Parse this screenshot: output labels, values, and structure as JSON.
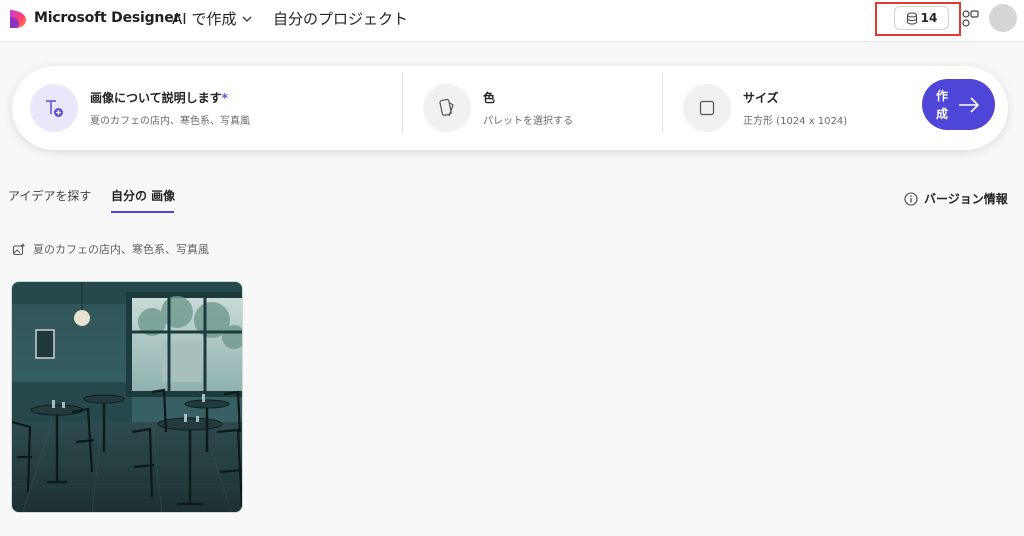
{
  "header": {
    "brand": "Microsoft Designer",
    "nav_ai": "AI で作成",
    "nav_projects": "自分のプロジェクト",
    "credits": "14"
  },
  "prompt_bar": {
    "describe": {
      "title": "画像について説明します",
      "required_mark": "*",
      "subtitle": "夏のカフェの店内、寒色系、写真風"
    },
    "color": {
      "title": "色",
      "subtitle": "パレットを選択する"
    },
    "size": {
      "title": "サイズ",
      "subtitle": "正方形 (1024 x 1024)"
    },
    "create_label": "作成"
  },
  "tabs": [
    {
      "label": "アイデアを探す"
    },
    {
      "label": "自分の 画像",
      "active": true
    }
  ],
  "version_info": "バージョン情報",
  "current_prompt": "夏のカフェの店内、寒色系、写真風",
  "colors": {
    "accent": "#4f46d8",
    "highlight": "#e03a2f"
  }
}
